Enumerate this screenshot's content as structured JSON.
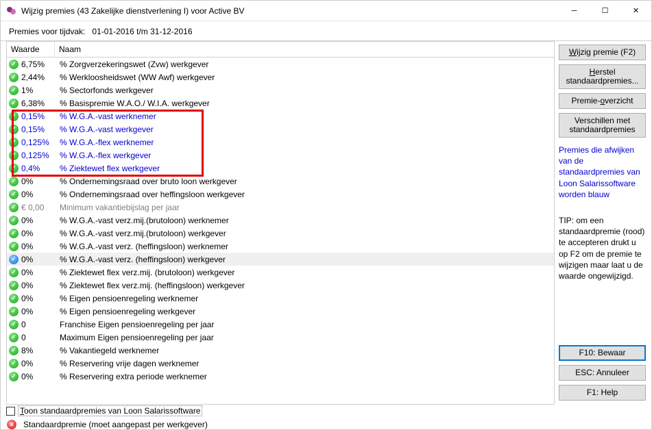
{
  "window": {
    "title": "Wijzig premies (43 Zakelijke dienstverlening I) voor Active BV"
  },
  "subheader": {
    "label": "Premies voor tijdvak:",
    "range": "01-01-2016 t/m 31-12-2016"
  },
  "columns": {
    "value": "Waarde",
    "name": "Naam"
  },
  "rows": [
    {
      "icon": "green",
      "value": "6,75%",
      "name": "% Zorgverzekeringswet (Zvw) werkgever",
      "cls": ""
    },
    {
      "icon": "green",
      "value": "2,44%",
      "name": "% Werkloosheidswet (WW Awf) werkgever",
      "cls": ""
    },
    {
      "icon": "green",
      "value": "1%",
      "name": "% Sectorfonds werkgever",
      "cls": ""
    },
    {
      "icon": "green",
      "value": "6,38%",
      "name": "% Basispremie W.A.O./ W.I.A. werkgever",
      "cls": ""
    },
    {
      "icon": "green",
      "value": "0,15%",
      "name": "% W.G.A.-vast werknemer",
      "cls": "blue"
    },
    {
      "icon": "green",
      "value": "0,15%",
      "name": "% W.G.A.-vast werkgever",
      "cls": "blue"
    },
    {
      "icon": "green",
      "value": "0,125%",
      "name": "% W.G.A.-flex werknemer",
      "cls": "blue"
    },
    {
      "icon": "green",
      "value": "0,125%",
      "name": "% W.G.A.-flex werkgever",
      "cls": "blue"
    },
    {
      "icon": "green",
      "value": "0,4%",
      "name": "% Ziektewet flex werkgever",
      "cls": "blue"
    },
    {
      "icon": "green",
      "value": "0%",
      "name": "% Ondernemingsraad over bruto loon werkgever",
      "cls": ""
    },
    {
      "icon": "green",
      "value": "0%",
      "name": "% Ondernemingsraad over heffingsloon werkgever",
      "cls": ""
    },
    {
      "icon": "green",
      "value": "€ 0,00",
      "name": "Minimum vakantiebijslag per jaar",
      "cls": "gray"
    },
    {
      "icon": "green",
      "value": "0%",
      "name": "% W.G.A.-vast verz.mij.(brutoloon) werknemer",
      "cls": ""
    },
    {
      "icon": "green",
      "value": "0%",
      "name": "% W.G.A.-vast verz.mij.(brutoloon) werkgever",
      "cls": ""
    },
    {
      "icon": "green",
      "value": "0%",
      "name": "% W.G.A.-vast verz. (heffingsloon) werknemer",
      "cls": ""
    },
    {
      "icon": "blue",
      "value": "0%",
      "name": "% W.G.A.-vast verz. (heffingsloon) werkgever",
      "cls": "sel"
    },
    {
      "icon": "green",
      "value": "0%",
      "name": "% Ziektewet flex verz.mij. (brutoloon) werkgever",
      "cls": ""
    },
    {
      "icon": "green",
      "value": "0%",
      "name": "% Ziektewet flex verz.mij. (heffingsloon) werkgever",
      "cls": ""
    },
    {
      "icon": "green",
      "value": "0%",
      "name": "% Eigen pensioenregeling werknemer",
      "cls": ""
    },
    {
      "icon": "green",
      "value": "0%",
      "name": "% Eigen pensioenregeling werkgever",
      "cls": ""
    },
    {
      "icon": "green",
      "value": "0",
      "name": "Franchise Eigen pensioenregeling per jaar",
      "cls": ""
    },
    {
      "icon": "green",
      "value": "0",
      "name": "Maximum Eigen pensioenregeling per jaar",
      "cls": ""
    },
    {
      "icon": "green",
      "value": "8%",
      "name": "% Vakantiegeld werknemer",
      "cls": ""
    },
    {
      "icon": "green",
      "value": "0%",
      "name": "% Reservering vrije dagen werknemer",
      "cls": ""
    },
    {
      "icon": "green",
      "value": "0%",
      "name": "% Reservering extra periode werknemer",
      "cls": ""
    }
  ],
  "checkbox": {
    "checked": false,
    "label": "Toon standaardpremies van Loon Salarissoftware"
  },
  "legend": {
    "label": "Standaardpremie (moet aangepast per werkgever)"
  },
  "side": {
    "btn_wijzig": "Wijzig premie (F2)",
    "btn_herstel": "Herstel standaardpremies...",
    "btn_overzicht": "Premie-overzicht",
    "btn_verschillen": "Verschillen met standaardpremies",
    "note1": "Premies die afwijken van de standaardpremies van Loon Salarissoftware worden blauw",
    "note2": "TIP: om een standaardpremie (rood) te accepteren drukt u op F2 om de premie te wijzigen maar laat u de waarde ongewijzigd.",
    "btn_bewaar": "F10: Bewaar",
    "btn_annuleer": "ESC: Annuleer",
    "btn_help": "F1: Help"
  }
}
